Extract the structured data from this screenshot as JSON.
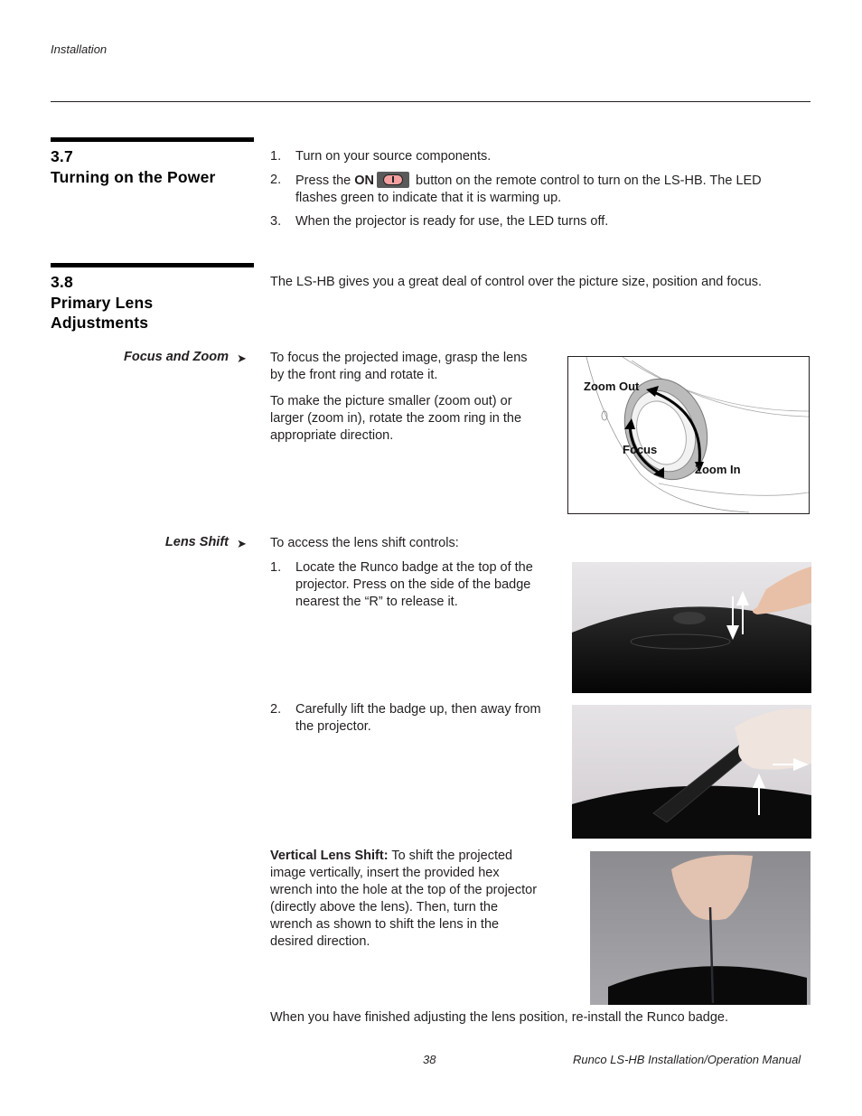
{
  "header": {
    "section_label": "Installation"
  },
  "sections": [
    {
      "number": "3.7",
      "title": "Turning on the Power",
      "steps": [
        {
          "num": "1.",
          "text": "Turn on your source components."
        },
        {
          "num": "2.",
          "text_before": "Press the ",
          "bold": "ON",
          "text_after_line1": " button on the remote control to turn on the LS-HB. The LED",
          "text_line2": "flashes green to indicate that it is warming up.",
          "icon": "power-on-button-icon"
        },
        {
          "num": "3.",
          "text": "When the projector is ready for use, the LED turns off."
        }
      ]
    },
    {
      "number": "3.8",
      "title_line1": "Primary Lens",
      "title_line2": "Adjustments",
      "intro": "The LS-HB gives you a great deal of control over the picture size, position and focus.",
      "subsections": [
        {
          "heading": "Focus and Zoom",
          "arrow": "➤",
          "paragraphs": [
            [
              "To focus the projected image, grasp the lens",
              "by the front ring and rotate it."
            ],
            [
              "To make the picture smaller (zoom out) or",
              "larger (zoom in), rotate the zoom ring in the",
              "appropriate direction."
            ]
          ],
          "figure_labels": {
            "zoom_out": "Zoom Out",
            "focus": "Focus",
            "zoom_in": "Zoom In"
          }
        },
        {
          "heading": "Lens Shift",
          "arrow": "➤",
          "intro": "To access the lens shift controls:",
          "steps": [
            {
              "num": "1.",
              "lines": [
                "Locate the Runco badge at the top of the",
                "projector. Press on the side of the badge",
                "nearest the “R” to release it."
              ]
            },
            {
              "num": "2.",
              "lines": [
                "Carefully lift the badge up, then away from",
                "the projector."
              ]
            }
          ],
          "vertical_shift": {
            "label": "Vertical Lens Shift:",
            "lines": [
              " To shift the projected",
              "image vertically, insert the provided hex",
              "wrench into the hole at the top of the projector",
              "(directly above the lens). Then, turn the",
              "wrench as shown to shift the lens in the",
              "desired direction."
            ]
          },
          "closing": "When you have finished adjusting the lens position, re-install the Runco badge."
        }
      ]
    }
  ],
  "footer": {
    "page_number": "38",
    "manual_title": "Runco LS-HB Installation/Operation Manual"
  }
}
